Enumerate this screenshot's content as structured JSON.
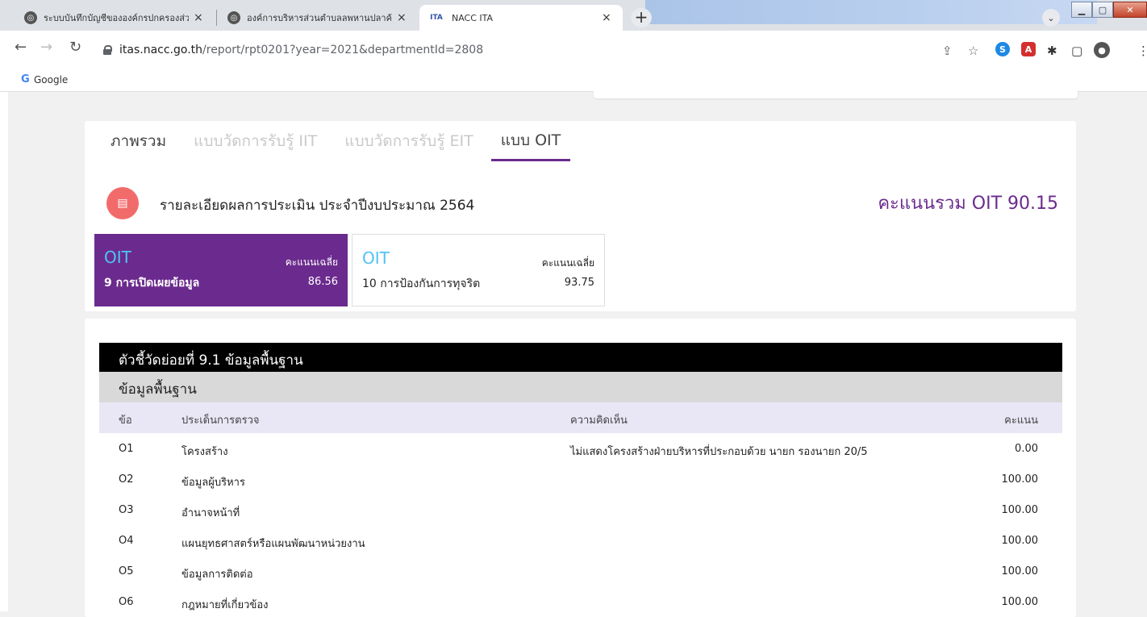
{
  "browser": {
    "tabs": [
      {
        "title": "ระบบบันทึกบัญชีขององค์กรปกครองส่วนท้องถิ่น"
      },
      {
        "title": "องค์การบริหารส่วนตำบลลพหานปลาค้าว"
      },
      {
        "title": "NACC ITA",
        "icon": "ITA"
      }
    ],
    "url_host": "itas.nacc.go.th",
    "url_path": "/report/rpt0201?year=2021&departmentId=2808",
    "bookmark": "Google"
  },
  "page": {
    "tabs": [
      "ภาพรวม",
      "แบบวัดการรับรู้ IIT",
      "แบบวัดการรับรู้ EIT",
      "แบบ OIT"
    ],
    "active_tab": 3,
    "header_title": "รายละเอียดผลการประเมิน ประจำปีงบประมาณ 2564",
    "total_score": "คะแนนรวม OIT 90.15",
    "boxes": [
      {
        "abbr": "OIT",
        "avg_label": "คะแนนเฉลี่ย",
        "name": "9 การเปิดเผยข้อมูล",
        "value": "86.56"
      },
      {
        "abbr": "OIT",
        "avg_label": "คะแนนเฉลี่ย",
        "name": "10 การป้องกันการทุจริต",
        "value": "93.75"
      }
    ],
    "indicator_title": "ตัวชี้วัดย่อยที่ 9.1 ข้อมูลพื้นฐาน",
    "section_title": "ข้อมูลพื้นฐาน",
    "table": {
      "headers": {
        "no": "ข้อ",
        "issue": "ประเด็นการตรวจ",
        "comment": "ความคิดเห็น",
        "score": "คะแนน"
      },
      "rows": [
        {
          "no": "O1",
          "issue": "โครงสร้าง",
          "comment": "ไม่แสดงโครงสร้างฝ่ายบริหารที่ประกอบด้วย นายก รองนายก 20/5",
          "score": "0.00"
        },
        {
          "no": "O2",
          "issue": "ข้อมูลผู้บริหาร",
          "comment": "",
          "score": "100.00"
        },
        {
          "no": "O3",
          "issue": "อำนาจหน้าที่",
          "comment": "",
          "score": "100.00"
        },
        {
          "no": "O4",
          "issue": "แผนยุทธศาสตร์หรือแผนพัฒนาหน่วยงาน",
          "comment": "",
          "score": "100.00"
        },
        {
          "no": "O5",
          "issue": "ข้อมูลการติดต่อ",
          "comment": "",
          "score": "100.00"
        },
        {
          "no": "O6",
          "issue": "กฎหมายที่เกี่ยวข้อง",
          "comment": "",
          "score": "100.00"
        }
      ]
    }
  }
}
